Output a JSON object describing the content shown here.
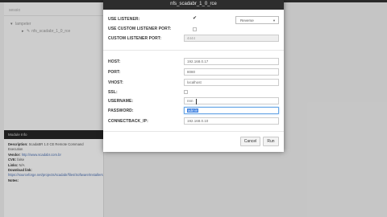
{
  "background": {
    "left_header": "sessio",
    "tree": [
      {
        "label": "lampeter",
        "expanded": true
      },
      {
        "label": "nfs_scadabr_1_0_rce"
      }
    ],
    "info": {
      "header": "Module Info",
      "description_label": "Description:",
      "description": "ScadaBR 1.0 CE Remote Command Execution",
      "vendor_label": "Vendor:",
      "vendor": "http://www.scadabr.com.br",
      "cve_label": "CVE:",
      "cve": "false",
      "links_label": "Links:",
      "links": "N/A",
      "download_label": "Download link:",
      "download": "https://sourceforge.net/projects/scadabr/files/Software/Installers",
      "notes_label": "Notes:"
    }
  },
  "dialog": {
    "title": "nfs_scadabr_1_0_rce",
    "use_listener_label": "USE LISTENER:",
    "use_listener_checked": "✔",
    "listener_select": "Reverse",
    "use_custom_port_label": "USE CUSTOM LISTENER PORT:",
    "custom_port_label": "CUSTOM LISTENER PORT:",
    "custom_port_value": "4444",
    "host_label": "HOST:",
    "host_value": "192.168.0.17",
    "port_label": "PORT:",
    "port_value": "8080",
    "vhost_label": "VHOST:",
    "vhost_value": "localhost",
    "ssl_label": "SSL:",
    "username_label": "USERNAME:",
    "username_value": "nnn",
    "password_label": "PASSWORD:",
    "password_value": "admin",
    "connectback_label": "CONNECTBACK_IP:",
    "connectback_value": "192.168.0.10",
    "cancel_label": "Cancel",
    "run_label": "Run"
  }
}
